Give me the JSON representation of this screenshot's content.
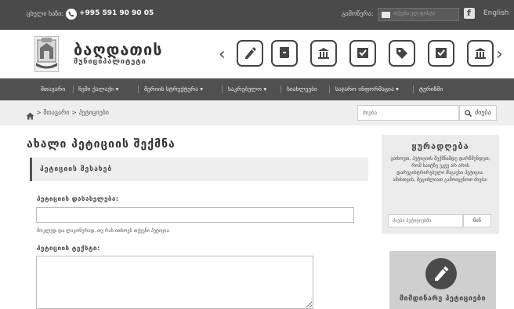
{
  "topbar": {
    "hotline_label": "ცხელი ხაზი:",
    "phone": "+995 591 90 90 05",
    "subscribe_label": "გამოწერა:",
    "email_placeholder": "თქვენი ელ.ფოსტა",
    "facebook_icon": "f",
    "language": "English"
  },
  "header": {
    "title": "ბაღდათის",
    "subtitle": "მუნიციპალიტეტი",
    "icons": [
      "petition-icon",
      "archive-icon",
      "government-building-icon",
      "vote-check-icon",
      "tag-icon",
      "vote-check-icon",
      "government-building-icon"
    ]
  },
  "nav": {
    "items": [
      "მთავარი",
      "ჩემი ქალაქი",
      "მერიის სტრუქტურა",
      "საკრებულო",
      "სიახლეები",
      "საჯარო ინფორმაცია",
      "ტურიზმი"
    ],
    "has_dropdown": [
      false,
      true,
      true,
      true,
      false,
      true,
      false
    ]
  },
  "breadcrumb": {
    "text": "> მთავარი > პეტიციები"
  },
  "search": {
    "placeholder": "ძიება",
    "button_label": "ძიება"
  },
  "main": {
    "page_title": "ახალი პეტიციის შექმნა",
    "section_title": "პეტიციის შესახებ",
    "title_label": "პეტიციის დასახელება:",
    "title_value": "",
    "title_hint": "მოკლედ და ლაკონურად, თუ რას ითხოვს თქვენი პეტიცია.",
    "text_label": "პეტიციის ტექსტი:",
    "text_value": ""
  },
  "sidebar": {
    "attention_title": "ყურადღება",
    "attention_body": "გთხოვთ, პეტიციის შექმნამდე დარწმუნდეთ, რომ საიტზე უკვე არ არის დარეგისტრირებული მსგავსი პეტიცია. ამისთვის, შეგიძლიათ გამოიყენოთ ძიება:",
    "search_placeholder": "ძიება პეტიციებში",
    "search_button": "წინ",
    "active_label": "მიმდინარე პეტიციები"
  },
  "colors": {
    "topbar": "#4a4a4a",
    "nav": "#505050",
    "strip": "#eeeeee",
    "sidebar_box": "#ebebeb",
    "active_box": "#cfcfcf"
  }
}
